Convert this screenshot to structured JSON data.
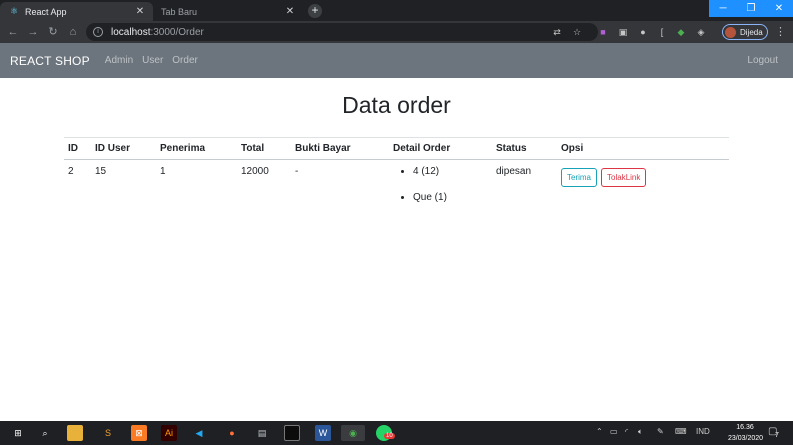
{
  "browser": {
    "tabs": [
      {
        "title": "React App",
        "active": true
      },
      {
        "title": "Tab Baru",
        "active": false
      }
    ],
    "url_host": "localhost",
    "url_path": ":3000/Order",
    "profile_name": "Dijeda"
  },
  "navbar": {
    "brand": "REACT SHOP",
    "links": [
      "Admin",
      "User",
      "Order"
    ],
    "logout": "Logout"
  },
  "page": {
    "title": "Data order",
    "table": {
      "headers": [
        "ID",
        "ID User",
        "Penerima",
        "Total",
        "Bukti Bayar",
        "Detail Order",
        "Status",
        "Opsi"
      ],
      "rows": [
        {
          "id": "2",
          "id_user": "15",
          "penerima": "1",
          "total": "12000",
          "bukti_bayar": "-",
          "detail": [
            "4 (12)",
            "Que (1)"
          ],
          "status": "dipesan",
          "actions": [
            "Terima",
            "TolakLink"
          ]
        }
      ]
    }
  },
  "taskbar": {
    "language": "IND",
    "time": "16.36",
    "date": "23/03/2020",
    "notification_count": "7",
    "chrome_badge": "10"
  },
  "colors": {
    "navbar_bg": "#6c757d",
    "accept": "#17a2b8",
    "reject": "#dc3545"
  }
}
